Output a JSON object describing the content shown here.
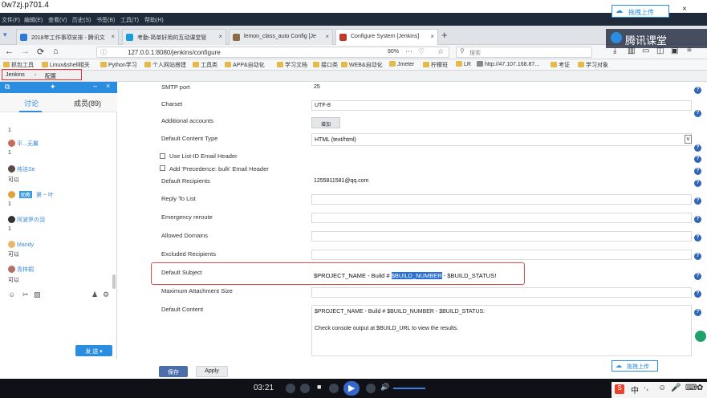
{
  "window": {
    "title": "0w7zj.p701.4"
  },
  "menu": [
    "文件(F)",
    "编辑(E)",
    "查看(V)",
    "历史(S)",
    "书签(B)",
    "工具(T)",
    "帮助(H)"
  ],
  "tabs": [
    {
      "label": "2018年工作事项安排 - 腾讯文",
      "color": "#2f7ad6"
    },
    {
      "label": "考勤-简单好用的互动课堂管",
      "color": "#1a9bdb"
    },
    {
      "label": "lemon_class_auto Config [Je",
      "color": "#8b6b43"
    },
    {
      "label": "Configure System [Jenkins]",
      "color": "#c0392b"
    }
  ],
  "toolbar": {
    "url": "127.0.0.1:8080/jenkins/configure",
    "zoom": "90%",
    "search_placeholder": "搜索"
  },
  "bookmarks": [
    "抓包工具",
    "Linux&shell相关",
    "Python学习",
    "个人网站搭建",
    "工具类",
    "APP&自动化",
    "学习文档",
    "接口类",
    "WEB&自动化",
    "Jmeter",
    "柠檬班",
    "LR",
    "http://47.107.168.87...",
    "考证",
    "学习对象"
  ],
  "breadcrumb": {
    "root": "Jenkins",
    "current": "配置"
  },
  "chat": {
    "tab_discussion": "讨论",
    "tab_members": "成员(89)",
    "messages": [
      {
        "name": "",
        "text": "1"
      },
      {
        "name": "平...无翼",
        "text": "1"
      },
      {
        "name": "纯洁Se",
        "text": "可以"
      },
      {
        "name": "第 ~ 叶",
        "text": "1"
      },
      {
        "name": "阿波罗の泪",
        "text": "1"
      },
      {
        "name": "Mandy",
        "text": "可以"
      },
      {
        "name": "青梓桐",
        "text": "可以"
      }
    ],
    "send_label": "发 送"
  },
  "form": {
    "smtp_port": {
      "label": "SMTP port",
      "value": "25"
    },
    "charset": {
      "label": "Charset",
      "value": "UTF-8"
    },
    "additional_accounts": {
      "label": "Additional accounts",
      "button": "增加"
    },
    "content_type": {
      "label": "Default Content Type",
      "value": "HTML (text/html)"
    },
    "list_id": {
      "label": "Use List-ID Email Header"
    },
    "precedence": {
      "label": "Add 'Precedence: bulk' Email Header"
    },
    "recipients": {
      "label": "Default Recipients",
      "value": "1255811581@qq.com"
    },
    "reply_to": {
      "label": "Reply To List",
      "value": ""
    },
    "emergency": {
      "label": "Emergency reroute",
      "value": ""
    },
    "allowed_domains": {
      "label": "Allowed Domains",
      "value": ""
    },
    "excluded": {
      "label": "Excluded Recipients",
      "value": ""
    },
    "subject": {
      "label": "Default Subject",
      "prefix": "$PROJECT_NAME - Build # ",
      "highlight": "$BUILD_NUMBER",
      "suffix": " - $BUILD_STATUS!"
    },
    "max_attach": {
      "label": "Maximum Attachment Size",
      "value": ""
    },
    "content": {
      "label": "Default Content",
      "line1": "$PROJECT_NAME - Build # $BUILD_NUMBER - $BUILD_STATUS:",
      "line2": "Check console output at $BUILD_URL to view the results."
    },
    "save_label": "保存",
    "apply_label": "Apply"
  },
  "video": {
    "time": "03:21"
  },
  "overlay": {
    "brand": "腾讯课堂",
    "upload_label": "拖拽上传"
  },
  "ime": {
    "label": "中"
  }
}
